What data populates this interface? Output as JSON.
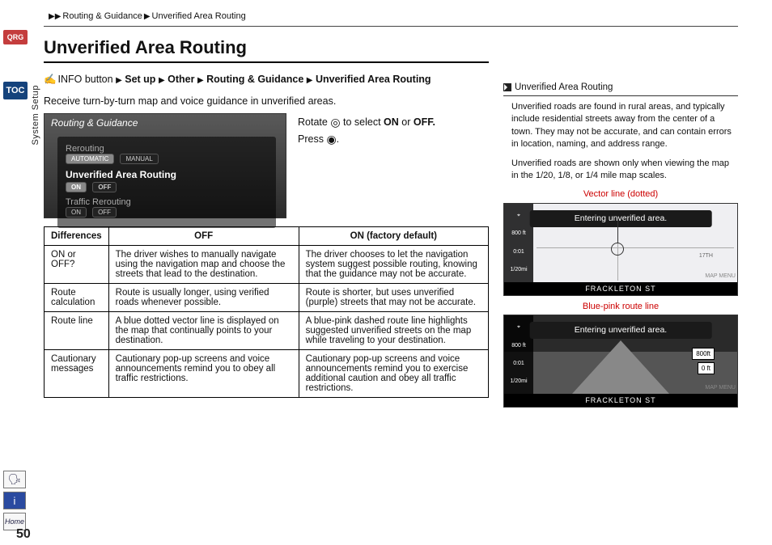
{
  "breadcrumb": {
    "seg1": "Routing & Guidance",
    "seg2": "Unverified Area Routing"
  },
  "badges": {
    "qrg": "QRG",
    "toc": "TOC"
  },
  "side_section": "System Setup",
  "side_home": "Home",
  "page_number": "50",
  "title": "Unverified Area Routing",
  "nav_path": {
    "info_btn": "INFO button",
    "p1": "Set up",
    "p2": "Other",
    "p3": "Routing & Guidance",
    "p4": "Unverified Area Routing"
  },
  "intro": "Receive turn-by-turn map and voice guidance in unverified areas.",
  "instructions": {
    "rotate_pre": "Rotate ",
    "rotate_post": " to select ",
    "on": "ON",
    "or": " or ",
    "off": "OFF.",
    "press_pre": "Press ",
    "press_post": "."
  },
  "device": {
    "header": "Routing & Guidance",
    "row1": "Rerouting",
    "row1_pills": {
      "a": "AUTOMATIC",
      "b": "MANUAL"
    },
    "row2": "Unverified Area Routing",
    "row2_pills": {
      "a": "ON",
      "b": "OFF"
    },
    "row3": "Traffic Rerouting",
    "row3_pills": {
      "a": "ON",
      "b": "OFF"
    }
  },
  "table": {
    "h1": "Differences",
    "h2": "OFF",
    "h3": "ON (factory default)",
    "rows": [
      {
        "label": "ON or OFF?",
        "off": "The driver wishes to manually navigate using the navigation map and choose the streets that lead to the destination.",
        "on": "The driver chooses to let the navigation system suggest possible routing, knowing that the guidance may not be accurate."
      },
      {
        "label": "Route calculation",
        "off": "Route is usually longer, using verified roads whenever possible.",
        "on": "Route is shorter, but uses unverified (purple) streets that may not be accurate."
      },
      {
        "label": "Route line",
        "off": "A blue dotted vector line is displayed on the map that continually points to your destination.",
        "on": "A blue-pink dashed route line highlights suggested unverified streets on the map while traveling to your destination."
      },
      {
        "label": "Cautionary messages",
        "off": "Cautionary pop-up screens and voice announcements remind you to obey all traffic restrictions.",
        "on": "Cautionary pop-up screens and voice announcements remind you to exercise additional caution and obey all traffic restrictions."
      }
    ]
  },
  "right": {
    "head": "Unverified Area Routing",
    "p1": "Unverified roads are found in rural areas, and typically include residential streets away from the center of a town. They may not be accurate, and can contain errors in location, naming, and address range.",
    "p2": "Unverified roads are shown only when viewing the map in the 1/20, 1/8, or 1/4 mile map scales.",
    "cap1": "Vector line (dotted)",
    "cap2": "Blue-pink route line",
    "banner": "Entering unverified area.",
    "frack": "FRACKLETON ST",
    "side_ft": "800 ft",
    "side_time": "0:01",
    "side_scale": "1/20mi",
    "map_menu": "MAP MENU",
    "dist": "800ft",
    "dist2": "0 ft",
    "label_17th": "17TH"
  }
}
